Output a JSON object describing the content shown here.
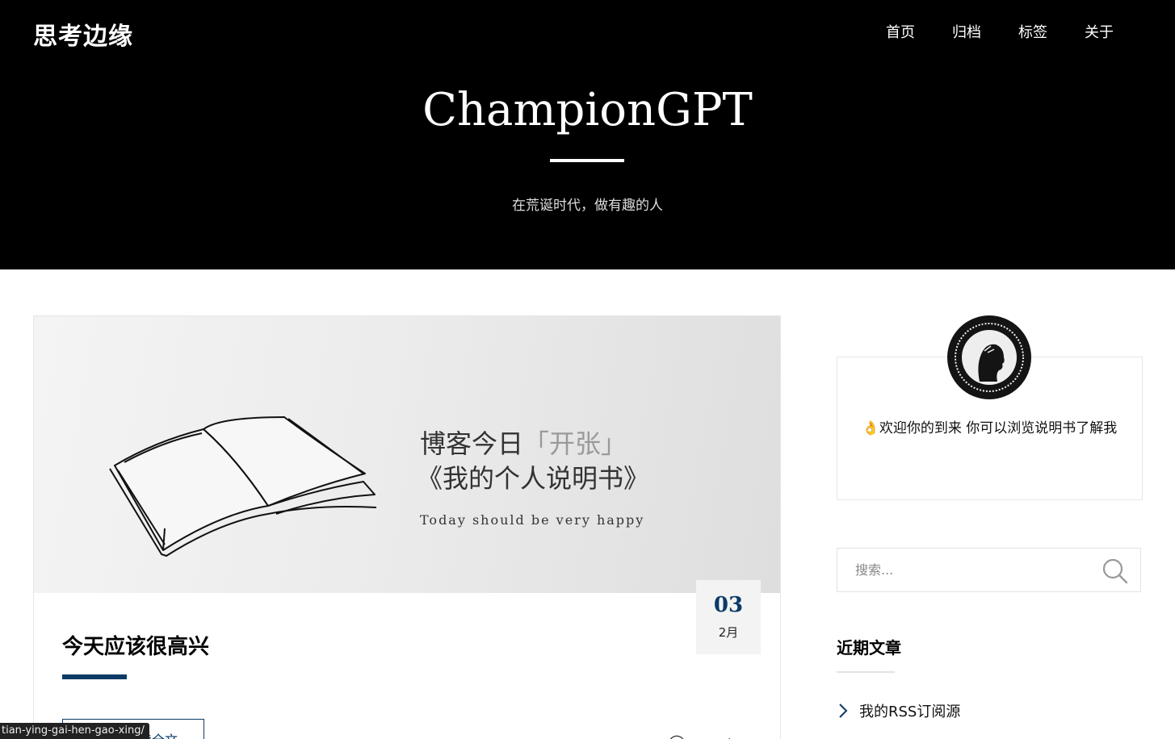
{
  "site": {
    "brand": "思考边缘",
    "nav": [
      "首页",
      "归档",
      "标签",
      "关于"
    ],
    "hero_title": "ChampionGPT",
    "hero_subtitle": "在荒诞时代，做有趣的人"
  },
  "post": {
    "image_text": {
      "line1_main": "博客今日",
      "line1_accent": "「开张」",
      "line2": "《我的个人说明书》",
      "line3": "Today should be very happy"
    },
    "date_day": "03",
    "date_month": "2月",
    "title": "今天应该很高兴",
    "read_more": "阅读全文",
    "status_url": "tian-ying-gai-hen-gao-xing/"
  },
  "sidebar": {
    "about_text": "👌欢迎你的到来 你可以浏览说明书了解我",
    "search_placeholder": "搜索...",
    "recent_title": "近期文章",
    "recent_items": [
      "我的RSS订阅源"
    ]
  },
  "colors": {
    "accent": "#0b3a66",
    "header_bg": "#000000"
  }
}
